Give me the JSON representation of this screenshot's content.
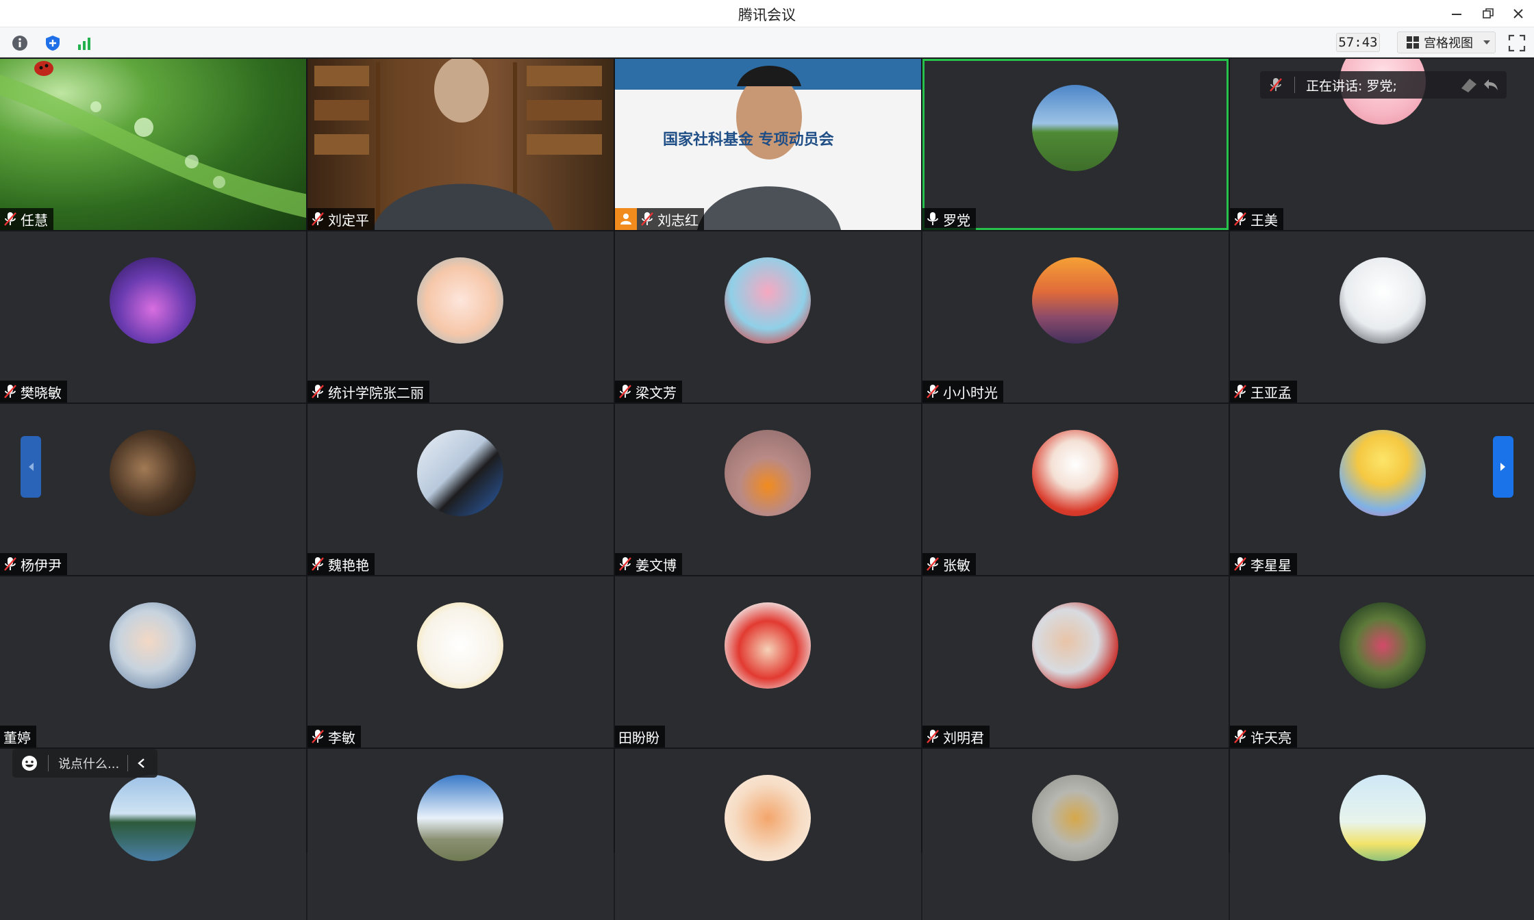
{
  "window": {
    "title": "腾讯会议"
  },
  "toolbar": {
    "timer": "57:43",
    "view_label": "宫格视图"
  },
  "speaking": {
    "text": "正在讲话: 罗党;"
  },
  "chat": {
    "placeholder": "说点什么..."
  },
  "colors": {
    "speaking_outline": "#27c24c",
    "accent": "#1a73e8",
    "tile_bg": "#2a2c30"
  },
  "participants": [
    {
      "name": "任慧",
      "mic": "muted"
    },
    {
      "name": "刘定平",
      "mic": "muted"
    },
    {
      "name": "刘志红",
      "mic": "muted",
      "host_badge": true,
      "slide_text": "国家社科基金          专项动员会"
    },
    {
      "name": "罗党",
      "mic": "on",
      "speaking": true
    },
    {
      "name": "王美",
      "mic": "muted"
    },
    {
      "name": "樊晓敏",
      "mic": "muted"
    },
    {
      "name": "统计学院张二丽",
      "mic": "muted"
    },
    {
      "name": "梁文芳",
      "mic": "muted"
    },
    {
      "name": "小小时光",
      "mic": "muted"
    },
    {
      "name": "王亚孟",
      "mic": "muted"
    },
    {
      "name": "杨伊尹",
      "mic": "muted"
    },
    {
      "name": "魏艳艳",
      "mic": "muted"
    },
    {
      "name": "姜文博",
      "mic": "muted"
    },
    {
      "name": "张敏",
      "mic": "muted"
    },
    {
      "name": "李星星",
      "mic": "muted"
    },
    {
      "name": "董婷",
      "mic": "none"
    },
    {
      "name": "李敏",
      "mic": "muted"
    },
    {
      "name": "田盼盼",
      "mic": "none"
    },
    {
      "name": "刘明君",
      "mic": "muted"
    },
    {
      "name": "许天亮",
      "mic": "muted"
    },
    {
      "name": "",
      "mic": "none"
    },
    {
      "name": "",
      "mic": "none"
    },
    {
      "name": "",
      "mic": "none"
    },
    {
      "name": "",
      "mic": "none"
    },
    {
      "name": "",
      "mic": "none"
    }
  ]
}
